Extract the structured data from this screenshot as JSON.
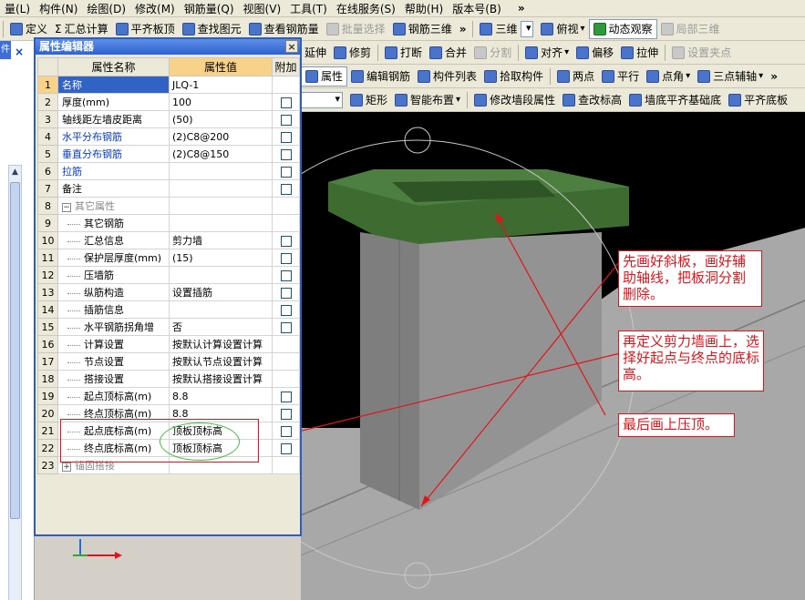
{
  "menu": {
    "items": [
      "量(L)",
      "构件(N)",
      "绘图(D)",
      "修改(M)",
      "钢筋量(Q)",
      "视图(V)",
      "工具(T)",
      "在线服务(S)",
      "帮助(H)",
      "版本号(B)"
    ],
    "more": "»"
  },
  "toolbar1": {
    "items": [
      {
        "label": "定义",
        "icon": "define-icon",
        "disabled": false
      },
      {
        "label": "汇总计算",
        "icon": "sigma-icon",
        "disabled": false
      },
      {
        "label": "平齐板顶",
        "icon": "align-slab-icon",
        "disabled": false
      },
      {
        "label": "查找图元",
        "icon": "find-element-icon",
        "disabled": false
      },
      {
        "label": "查看钢筋量",
        "icon": "view-rebar-icon",
        "disabled": false
      },
      {
        "label": "批量选择",
        "icon": "batch-select-icon",
        "disabled": true
      },
      {
        "label": "钢筋三维",
        "icon": "rebar-3d-icon",
        "disabled": false
      }
    ],
    "more": "»",
    "view_items": [
      {
        "label": "三维",
        "icon": "cube-3d-icon",
        "disabled": false
      },
      {
        "label": "俯视",
        "icon": "top-view-icon",
        "disabled": false
      },
      {
        "label": "动态观察",
        "icon": "orbit-icon",
        "disabled": false,
        "pressed": true
      },
      {
        "label": "局部三维",
        "icon": "local-3d-icon",
        "disabled": true
      }
    ]
  },
  "toolbar2": {
    "items": [
      {
        "label": "延伸",
        "icon": "extend-icon",
        "disabled": false
      },
      {
        "label": "修剪",
        "icon": "trim-icon",
        "disabled": false
      },
      {
        "label": "打断",
        "icon": "break-icon",
        "disabled": false
      },
      {
        "label": "合并",
        "icon": "merge-icon",
        "disabled": false
      },
      {
        "label": "分割",
        "icon": "split-icon",
        "disabled": true
      },
      {
        "label": "对齐",
        "icon": "align-icon",
        "disabled": false
      },
      {
        "label": "偏移",
        "icon": "offset-icon",
        "disabled": false
      },
      {
        "label": "拉伸",
        "icon": "stretch-icon",
        "disabled": false
      },
      {
        "label": "设置夹点",
        "icon": "grip-icon",
        "disabled": true
      }
    ]
  },
  "toolbar3": {
    "items": [
      {
        "label": "属性",
        "icon": "property-icon",
        "disabled": false,
        "pressed": true
      },
      {
        "label": "编辑钢筋",
        "icon": "edit-rebar-icon",
        "disabled": false
      },
      {
        "label": "构件列表",
        "icon": "component-list-icon",
        "disabled": false
      },
      {
        "label": "拾取构件",
        "icon": "pick-component-icon",
        "disabled": false
      },
      {
        "label": "两点",
        "icon": "two-point-icon",
        "disabled": false
      },
      {
        "label": "平行",
        "icon": "parallel-icon",
        "disabled": false
      },
      {
        "label": "点角",
        "icon": "point-angle-icon",
        "disabled": false
      },
      {
        "label": "三点辅轴",
        "icon": "three-point-axis-icon",
        "disabled": false
      }
    ],
    "more": "»"
  },
  "toolbar4": {
    "items": [
      {
        "label": "矩形",
        "icon": "rectangle-icon",
        "disabled": false
      },
      {
        "label": "智能布置",
        "icon": "smart-layout-icon",
        "disabled": false
      },
      {
        "label": "修改墙段属性",
        "icon": "modify-wall-icon",
        "disabled": false
      },
      {
        "label": "查改标高",
        "icon": "check-elevation-icon",
        "disabled": false
      },
      {
        "label": "墙底平齐基础底",
        "icon": "wall-bottom-icon",
        "disabled": false
      },
      {
        "label": "平齐底板",
        "icon": "align-bottom-icon",
        "disabled": false
      }
    ]
  },
  "left_panel": {
    "tab": "件",
    "close": "×"
  },
  "property_editor": {
    "title": "属性编辑器",
    "close": "×",
    "headers": {
      "name": "属性名称",
      "value": "属性值",
      "extra": "附加"
    },
    "rows": [
      {
        "n": "1",
        "name": "名称",
        "value": "JLQ-1",
        "check": false,
        "style": "selected"
      },
      {
        "n": "2",
        "name": "厚度(mm)",
        "value": "100",
        "check": true,
        "style": ""
      },
      {
        "n": "3",
        "name": "轴线距左墙皮距离",
        "value": "(50)",
        "check": true,
        "style": ""
      },
      {
        "n": "4",
        "name": "水平分布钢筋",
        "value": "(2)C8@200",
        "check": true,
        "style": "blue"
      },
      {
        "n": "5",
        "name": "垂直分布钢筋",
        "value": "(2)C8@150",
        "check": true,
        "style": "blue"
      },
      {
        "n": "6",
        "name": "拉筋",
        "value": "",
        "check": true,
        "style": "blue"
      },
      {
        "n": "7",
        "name": "备注",
        "value": "",
        "check": true,
        "style": ""
      },
      {
        "n": "8",
        "name": "其它属性",
        "value": "",
        "check": false,
        "style": "group",
        "tree": "−"
      },
      {
        "n": "9",
        "name": "其它钢筋",
        "value": "",
        "check": false,
        "style": "child"
      },
      {
        "n": "10",
        "name": "汇总信息",
        "value": "剪力墙",
        "check": true,
        "style": "child"
      },
      {
        "n": "11",
        "name": "保护层厚度(mm)",
        "value": "(15)",
        "check": true,
        "style": "child"
      },
      {
        "n": "12",
        "name": "压墙筋",
        "value": "",
        "check": true,
        "style": "child"
      },
      {
        "n": "13",
        "name": "纵筋构造",
        "value": "设置插筋",
        "check": true,
        "style": "child"
      },
      {
        "n": "14",
        "name": "插筋信息",
        "value": "",
        "check": true,
        "style": "child"
      },
      {
        "n": "15",
        "name": "水平钢筋拐角增",
        "value": "否",
        "check": true,
        "style": "child"
      },
      {
        "n": "16",
        "name": "计算设置",
        "value": "按默认计算设置计算",
        "check": false,
        "style": "child"
      },
      {
        "n": "17",
        "name": "节点设置",
        "value": "按默认节点设置计算",
        "check": false,
        "style": "child"
      },
      {
        "n": "18",
        "name": "搭接设置",
        "value": "按默认搭接设置计算",
        "check": false,
        "style": "child"
      },
      {
        "n": "19",
        "name": "起点顶标高(m)",
        "value": "8.8",
        "check": true,
        "style": "child"
      },
      {
        "n": "20",
        "name": "终点顶标高(m)",
        "value": "8.8",
        "check": true,
        "style": "child"
      },
      {
        "n": "21",
        "name": "起点底标高(m)",
        "value": "顶板顶标高",
        "check": true,
        "style": "child"
      },
      {
        "n": "22",
        "name": "终点底标高(m)",
        "value": "顶板顶标高",
        "check": true,
        "style": "child"
      },
      {
        "n": "23",
        "name": "锚固搭接",
        "value": "",
        "check": false,
        "style": "group",
        "tree": "+"
      }
    ]
  },
  "annotations": {
    "note1": "先画好斜板，画好辅助轴线，把板洞分割删除。",
    "note2": "再定义剪力墙画上，选择好起点与终点的底标高。",
    "note3": "最后画上压顶。"
  },
  "colors": {
    "annotation_red": "#e0151b",
    "highlight_green": "#3fbf3f",
    "cap_green": "#3d6b30",
    "wall_grey": "#8c8c8c",
    "slab_grey": "#a8a8a8",
    "title_blue": "#2f62d0",
    "selected_row": "#3163c5",
    "header_orange": "#f9d28a"
  }
}
